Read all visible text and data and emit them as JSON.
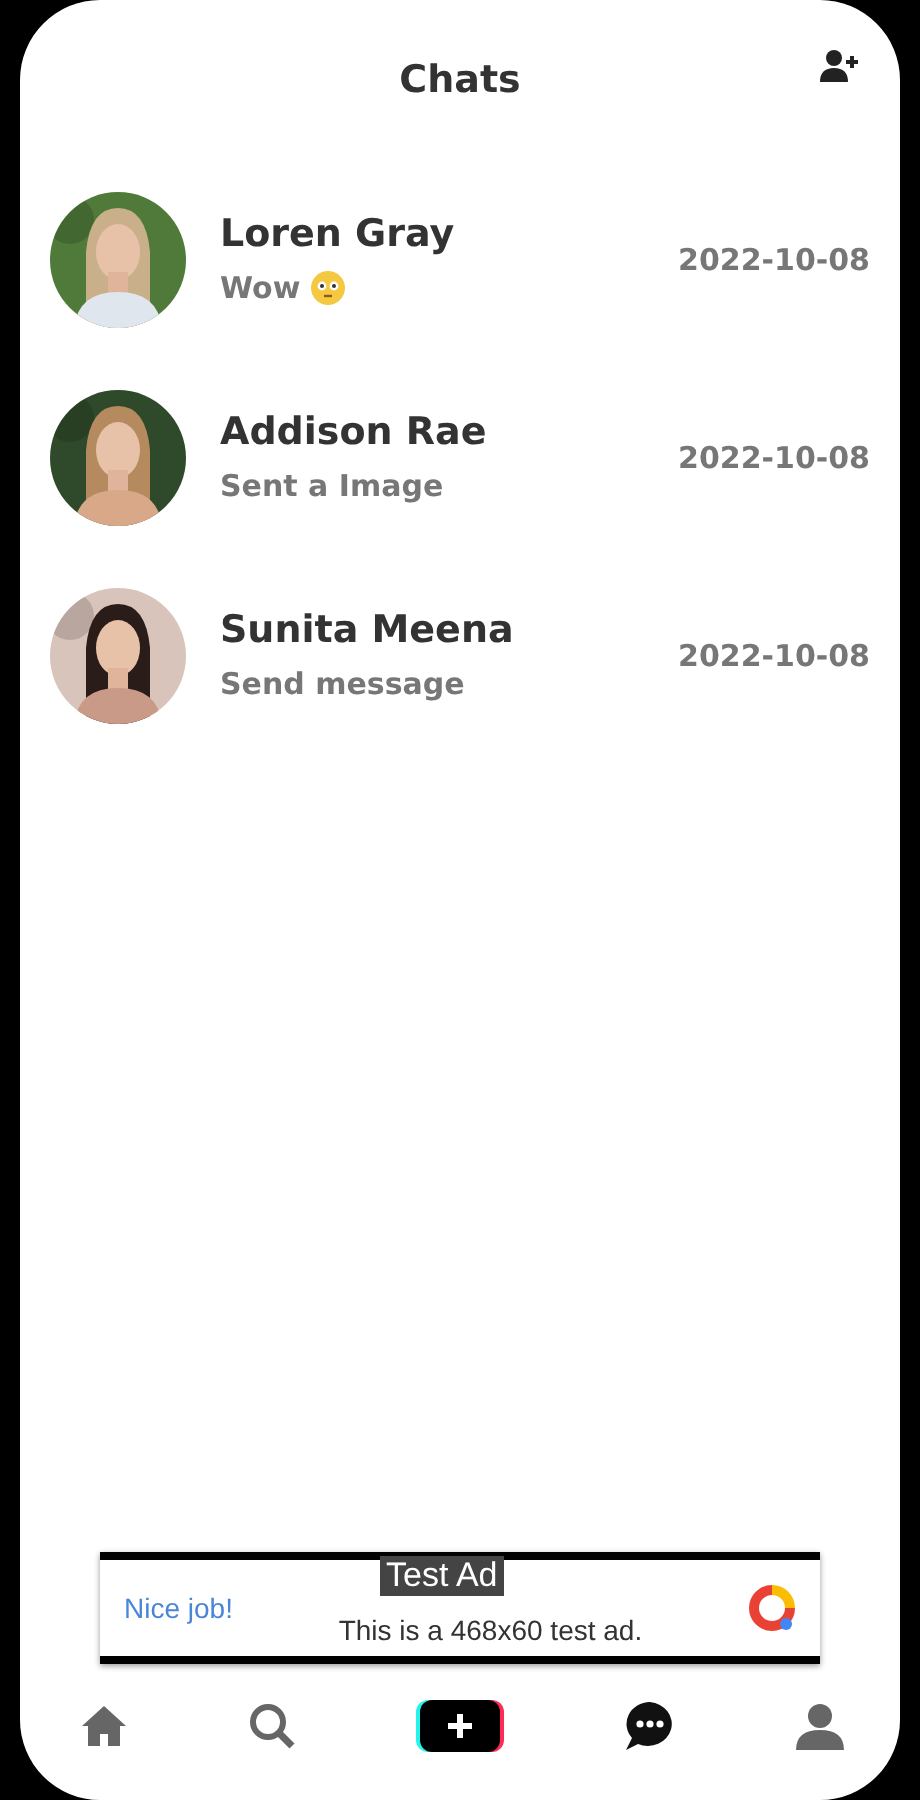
{
  "header": {
    "title": "Chats"
  },
  "chats": [
    {
      "name": "Loren Gray",
      "kind": "emoji",
      "message": "Wow",
      "date": "2022-10-08"
    },
    {
      "name": "Addison Rae",
      "kind": "text",
      "message": "Sent a Image",
      "date": "2022-10-08"
    },
    {
      "name": "Sunita Meena",
      "kind": "text",
      "message": "Send message",
      "date": "2022-10-08"
    }
  ],
  "ad": {
    "label": "Test Ad",
    "headline": "Nice job!",
    "text": "This is a 468x60 test ad."
  },
  "nav": [
    {
      "kind": "home",
      "selected": false
    },
    {
      "kind": "search",
      "selected": false
    },
    {
      "kind": "create",
      "selected": false
    },
    {
      "kind": "chat",
      "selected": true
    },
    {
      "kind": "profile",
      "selected": false
    }
  ]
}
